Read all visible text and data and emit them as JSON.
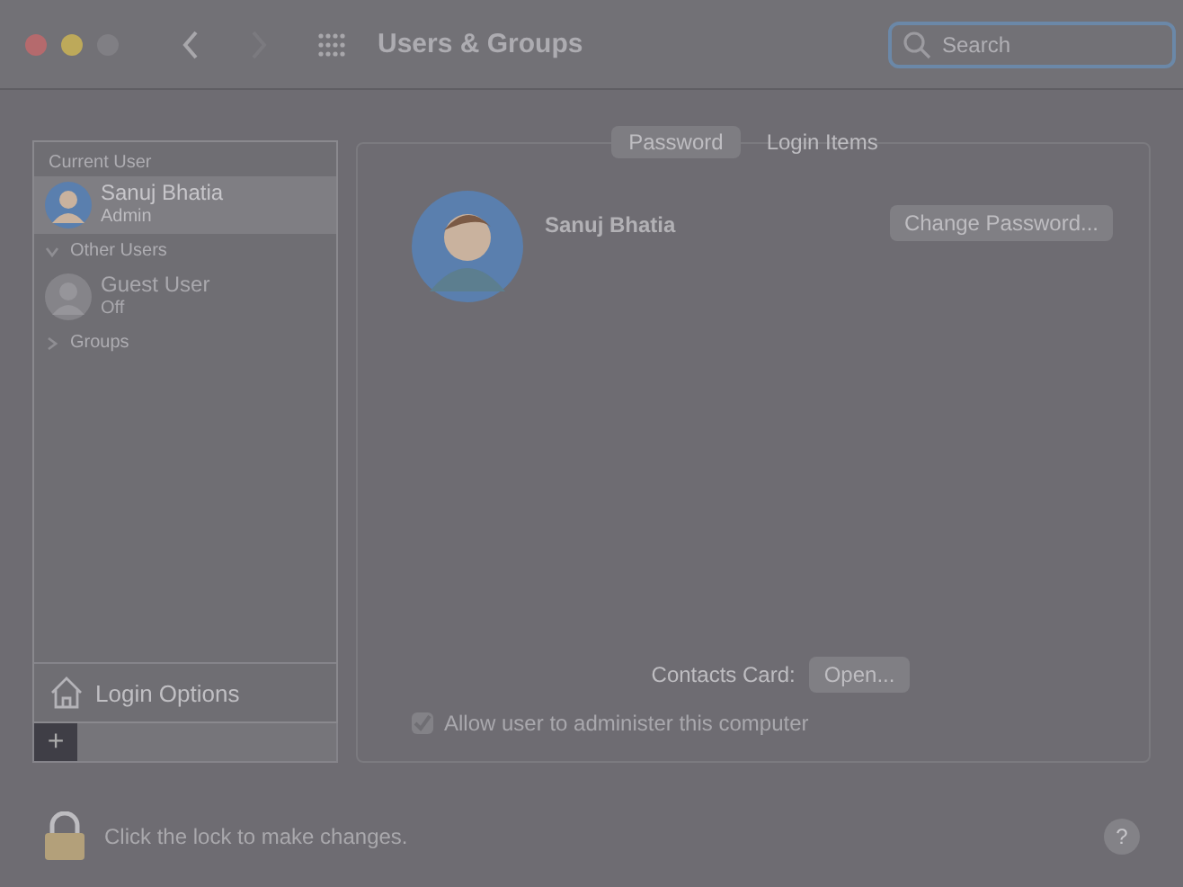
{
  "window": {
    "title": "Users & Groups"
  },
  "search": {
    "placeholder": "Search"
  },
  "sidebar": {
    "items": [
      {
        "kind": "heading",
        "label": "Current User"
      },
      {
        "kind": "user",
        "name": "Sanuj Bhatia",
        "role": "Admin",
        "selected": true,
        "disabled": false
      },
      {
        "kind": "group",
        "label": "Other Users",
        "expanded": true
      },
      {
        "kind": "user",
        "name": "Guest User",
        "role": "Off",
        "selected": false,
        "disabled": true
      },
      {
        "kind": "group",
        "label": "Groups",
        "expanded": false
      }
    ],
    "login_options": "Login Options",
    "add_button": "+"
  },
  "tabs": [
    {
      "label": "Password",
      "selected": true
    },
    {
      "label": "Login Items",
      "selected": false
    }
  ],
  "user_panel": {
    "name": "Sanuj Bhatia",
    "change_password": "Change Password...",
    "contacts_label": "Contacts Card:",
    "open_button": "Open...",
    "admin_checkbox": {
      "label": "Allow user to administer this computer",
      "checked": true,
      "disabled": true
    }
  },
  "footer": {
    "lock_text": "Click the lock to make changes.",
    "help": "?"
  }
}
